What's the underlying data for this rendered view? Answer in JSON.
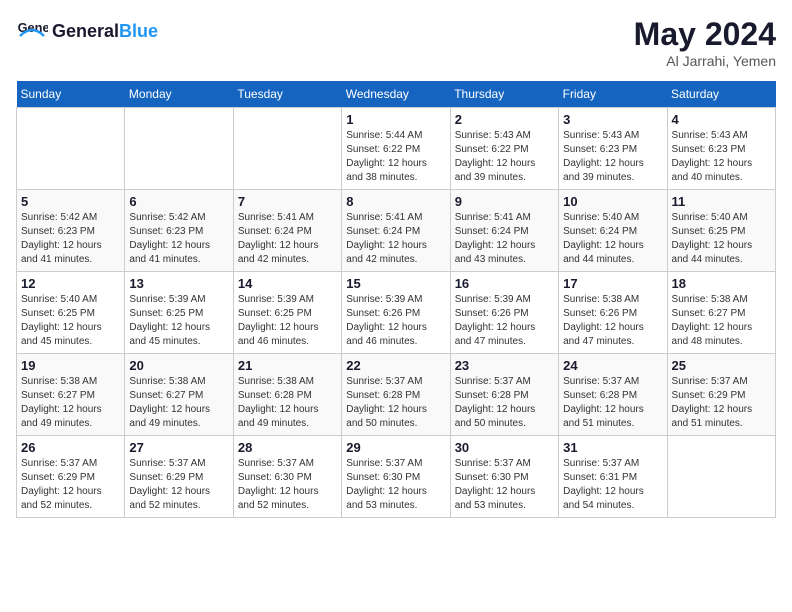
{
  "header": {
    "logo_general": "General",
    "logo_blue": "Blue",
    "title": "May 2024",
    "location": "Al Jarrahi, Yemen"
  },
  "days_of_week": [
    "Sunday",
    "Monday",
    "Tuesday",
    "Wednesday",
    "Thursday",
    "Friday",
    "Saturday"
  ],
  "weeks": [
    [
      {
        "day": "",
        "sunrise": "",
        "sunset": "",
        "daylight": ""
      },
      {
        "day": "",
        "sunrise": "",
        "sunset": "",
        "daylight": ""
      },
      {
        "day": "",
        "sunrise": "",
        "sunset": "",
        "daylight": ""
      },
      {
        "day": "1",
        "sunrise": "Sunrise: 5:44 AM",
        "sunset": "Sunset: 6:22 PM",
        "daylight": "Daylight: 12 hours and 38 minutes."
      },
      {
        "day": "2",
        "sunrise": "Sunrise: 5:43 AM",
        "sunset": "Sunset: 6:22 PM",
        "daylight": "Daylight: 12 hours and 39 minutes."
      },
      {
        "day": "3",
        "sunrise": "Sunrise: 5:43 AM",
        "sunset": "Sunset: 6:23 PM",
        "daylight": "Daylight: 12 hours and 39 minutes."
      },
      {
        "day": "4",
        "sunrise": "Sunrise: 5:43 AM",
        "sunset": "Sunset: 6:23 PM",
        "daylight": "Daylight: 12 hours and 40 minutes."
      }
    ],
    [
      {
        "day": "5",
        "sunrise": "Sunrise: 5:42 AM",
        "sunset": "Sunset: 6:23 PM",
        "daylight": "Daylight: 12 hours and 41 minutes."
      },
      {
        "day": "6",
        "sunrise": "Sunrise: 5:42 AM",
        "sunset": "Sunset: 6:23 PM",
        "daylight": "Daylight: 12 hours and 41 minutes."
      },
      {
        "day": "7",
        "sunrise": "Sunrise: 5:41 AM",
        "sunset": "Sunset: 6:24 PM",
        "daylight": "Daylight: 12 hours and 42 minutes."
      },
      {
        "day": "8",
        "sunrise": "Sunrise: 5:41 AM",
        "sunset": "Sunset: 6:24 PM",
        "daylight": "Daylight: 12 hours and 42 minutes."
      },
      {
        "day": "9",
        "sunrise": "Sunrise: 5:41 AM",
        "sunset": "Sunset: 6:24 PM",
        "daylight": "Daylight: 12 hours and 43 minutes."
      },
      {
        "day": "10",
        "sunrise": "Sunrise: 5:40 AM",
        "sunset": "Sunset: 6:24 PM",
        "daylight": "Daylight: 12 hours and 44 minutes."
      },
      {
        "day": "11",
        "sunrise": "Sunrise: 5:40 AM",
        "sunset": "Sunset: 6:25 PM",
        "daylight": "Daylight: 12 hours and 44 minutes."
      }
    ],
    [
      {
        "day": "12",
        "sunrise": "Sunrise: 5:40 AM",
        "sunset": "Sunset: 6:25 PM",
        "daylight": "Daylight: 12 hours and 45 minutes."
      },
      {
        "day": "13",
        "sunrise": "Sunrise: 5:39 AM",
        "sunset": "Sunset: 6:25 PM",
        "daylight": "Daylight: 12 hours and 45 minutes."
      },
      {
        "day": "14",
        "sunrise": "Sunrise: 5:39 AM",
        "sunset": "Sunset: 6:25 PM",
        "daylight": "Daylight: 12 hours and 46 minutes."
      },
      {
        "day": "15",
        "sunrise": "Sunrise: 5:39 AM",
        "sunset": "Sunset: 6:26 PM",
        "daylight": "Daylight: 12 hours and 46 minutes."
      },
      {
        "day": "16",
        "sunrise": "Sunrise: 5:39 AM",
        "sunset": "Sunset: 6:26 PM",
        "daylight": "Daylight: 12 hours and 47 minutes."
      },
      {
        "day": "17",
        "sunrise": "Sunrise: 5:38 AM",
        "sunset": "Sunset: 6:26 PM",
        "daylight": "Daylight: 12 hours and 47 minutes."
      },
      {
        "day": "18",
        "sunrise": "Sunrise: 5:38 AM",
        "sunset": "Sunset: 6:27 PM",
        "daylight": "Daylight: 12 hours and 48 minutes."
      }
    ],
    [
      {
        "day": "19",
        "sunrise": "Sunrise: 5:38 AM",
        "sunset": "Sunset: 6:27 PM",
        "daylight": "Daylight: 12 hours and 49 minutes."
      },
      {
        "day": "20",
        "sunrise": "Sunrise: 5:38 AM",
        "sunset": "Sunset: 6:27 PM",
        "daylight": "Daylight: 12 hours and 49 minutes."
      },
      {
        "day": "21",
        "sunrise": "Sunrise: 5:38 AM",
        "sunset": "Sunset: 6:28 PM",
        "daylight": "Daylight: 12 hours and 49 minutes."
      },
      {
        "day": "22",
        "sunrise": "Sunrise: 5:37 AM",
        "sunset": "Sunset: 6:28 PM",
        "daylight": "Daylight: 12 hours and 50 minutes."
      },
      {
        "day": "23",
        "sunrise": "Sunrise: 5:37 AM",
        "sunset": "Sunset: 6:28 PM",
        "daylight": "Daylight: 12 hours and 50 minutes."
      },
      {
        "day": "24",
        "sunrise": "Sunrise: 5:37 AM",
        "sunset": "Sunset: 6:28 PM",
        "daylight": "Daylight: 12 hours and 51 minutes."
      },
      {
        "day": "25",
        "sunrise": "Sunrise: 5:37 AM",
        "sunset": "Sunset: 6:29 PM",
        "daylight": "Daylight: 12 hours and 51 minutes."
      }
    ],
    [
      {
        "day": "26",
        "sunrise": "Sunrise: 5:37 AM",
        "sunset": "Sunset: 6:29 PM",
        "daylight": "Daylight: 12 hours and 52 minutes."
      },
      {
        "day": "27",
        "sunrise": "Sunrise: 5:37 AM",
        "sunset": "Sunset: 6:29 PM",
        "daylight": "Daylight: 12 hours and 52 minutes."
      },
      {
        "day": "28",
        "sunrise": "Sunrise: 5:37 AM",
        "sunset": "Sunset: 6:30 PM",
        "daylight": "Daylight: 12 hours and 52 minutes."
      },
      {
        "day": "29",
        "sunrise": "Sunrise: 5:37 AM",
        "sunset": "Sunset: 6:30 PM",
        "daylight": "Daylight: 12 hours and 53 minutes."
      },
      {
        "day": "30",
        "sunrise": "Sunrise: 5:37 AM",
        "sunset": "Sunset: 6:30 PM",
        "daylight": "Daylight: 12 hours and 53 minutes."
      },
      {
        "day": "31",
        "sunrise": "Sunrise: 5:37 AM",
        "sunset": "Sunset: 6:31 PM",
        "daylight": "Daylight: 12 hours and 54 minutes."
      },
      {
        "day": "",
        "sunrise": "",
        "sunset": "",
        "daylight": ""
      }
    ]
  ]
}
